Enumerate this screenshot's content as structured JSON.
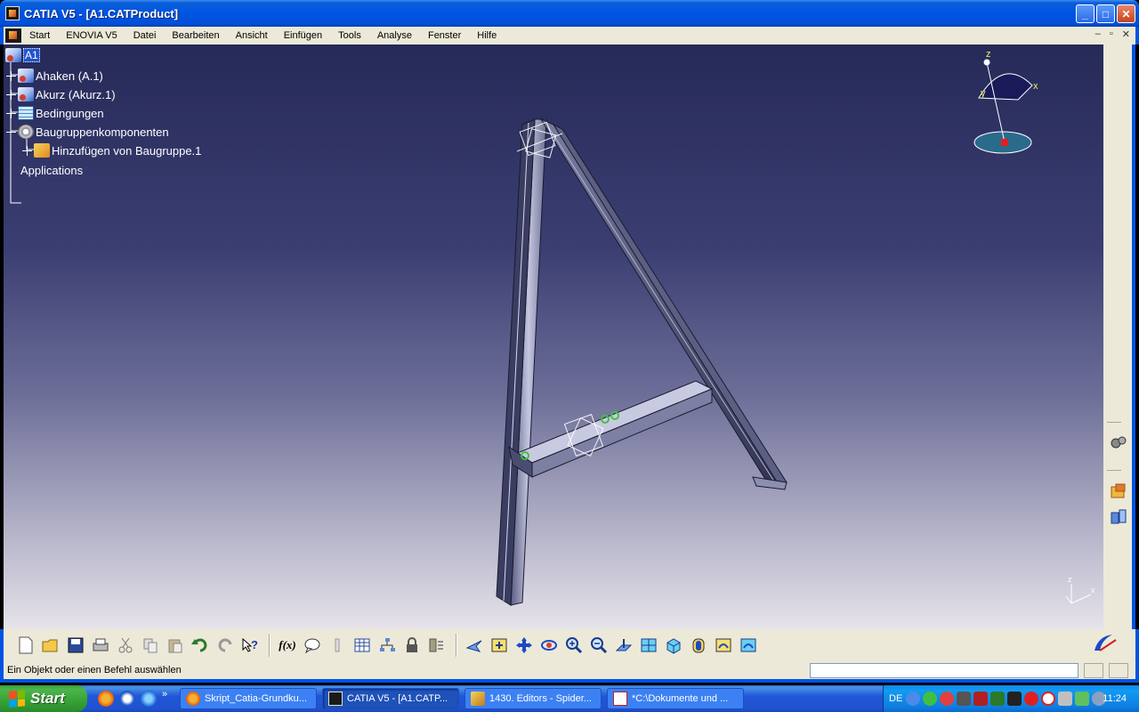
{
  "window": {
    "title": "CATIA V5 - [A1.CATProduct]",
    "buttons": {
      "minimize": "_",
      "maximize": "□",
      "close": "✕"
    }
  },
  "menu": {
    "items": [
      "Start",
      "ENOVIA V5",
      "Datei",
      "Bearbeiten",
      "Ansicht",
      "Einfügen",
      "Tools",
      "Analyse",
      "Fenster",
      "Hilfe"
    ],
    "mdi_buttons": [
      "–",
      "▫",
      "✕"
    ]
  },
  "tree": {
    "root": "A1",
    "nodes": [
      {
        "label": "Ahaken (A.1)",
        "icon": "product-icon"
      },
      {
        "label": "Akurz (Akurz.1)",
        "icon": "product-icon"
      },
      {
        "label": "Bedingungen",
        "icon": "constraints-icon"
      },
      {
        "label": "Baugruppenkomponenten",
        "icon": "assembly-features-icon"
      },
      {
        "label": "Hinzufügen von Baugruppe.1",
        "icon": "assembly-icon"
      },
      {
        "label": "Applications",
        "icon": ""
      }
    ]
  },
  "compass": {
    "labels": {
      "x": "x",
      "y": "y",
      "z": "z"
    }
  },
  "axis_triad": {
    "labels": {
      "x": "x",
      "z": "z"
    }
  },
  "toolbar": {
    "icons": [
      "new-icon",
      "open-icon",
      "save-icon",
      "print-icon",
      "cut-icon",
      "copy-icon",
      "paste-icon",
      "undo-icon",
      "redo-icon",
      "whats-this-icon",
      "formula-icon",
      "comment-icon",
      "knowledge-icon",
      "table-icon",
      "tree-icon",
      "lock-icon",
      "catalog-icon",
      "fly-mode-icon",
      "fit-all-icon",
      "pan-icon",
      "rotate-icon",
      "zoom-in-icon",
      "zoom-out-icon",
      "normal-view-icon",
      "multi-view-icon",
      "iso-view-icon",
      "shading-icon",
      "hide-show-icon",
      "swap-visible-icon"
    ],
    "formula_label": "f(x)"
  },
  "status": {
    "message": "Ein Objekt oder einen Befehl auswählen",
    "command_value": ""
  },
  "taskbar": {
    "start_label": "Start",
    "tasks": [
      {
        "label": "Skript_Catia-Grundku...",
        "icon": "firefox-icon"
      },
      {
        "label": "CATIA V5 - [A1.CATP...",
        "icon": "catia-icon"
      },
      {
        "label": "1430. Editors - Spider...",
        "icon": "spider-icon"
      },
      {
        "label": "*C:\\Dokumente und ...",
        "icon": "editor-icon"
      }
    ],
    "language": "DE",
    "clock": "11:24"
  },
  "colors": {
    "xp_blue": "#0054e3",
    "viewport_top": "#262a58",
    "viewport_bottom": "#e6e3ea",
    "part_face": "#b4b8d8",
    "start_green": "#36a236"
  }
}
